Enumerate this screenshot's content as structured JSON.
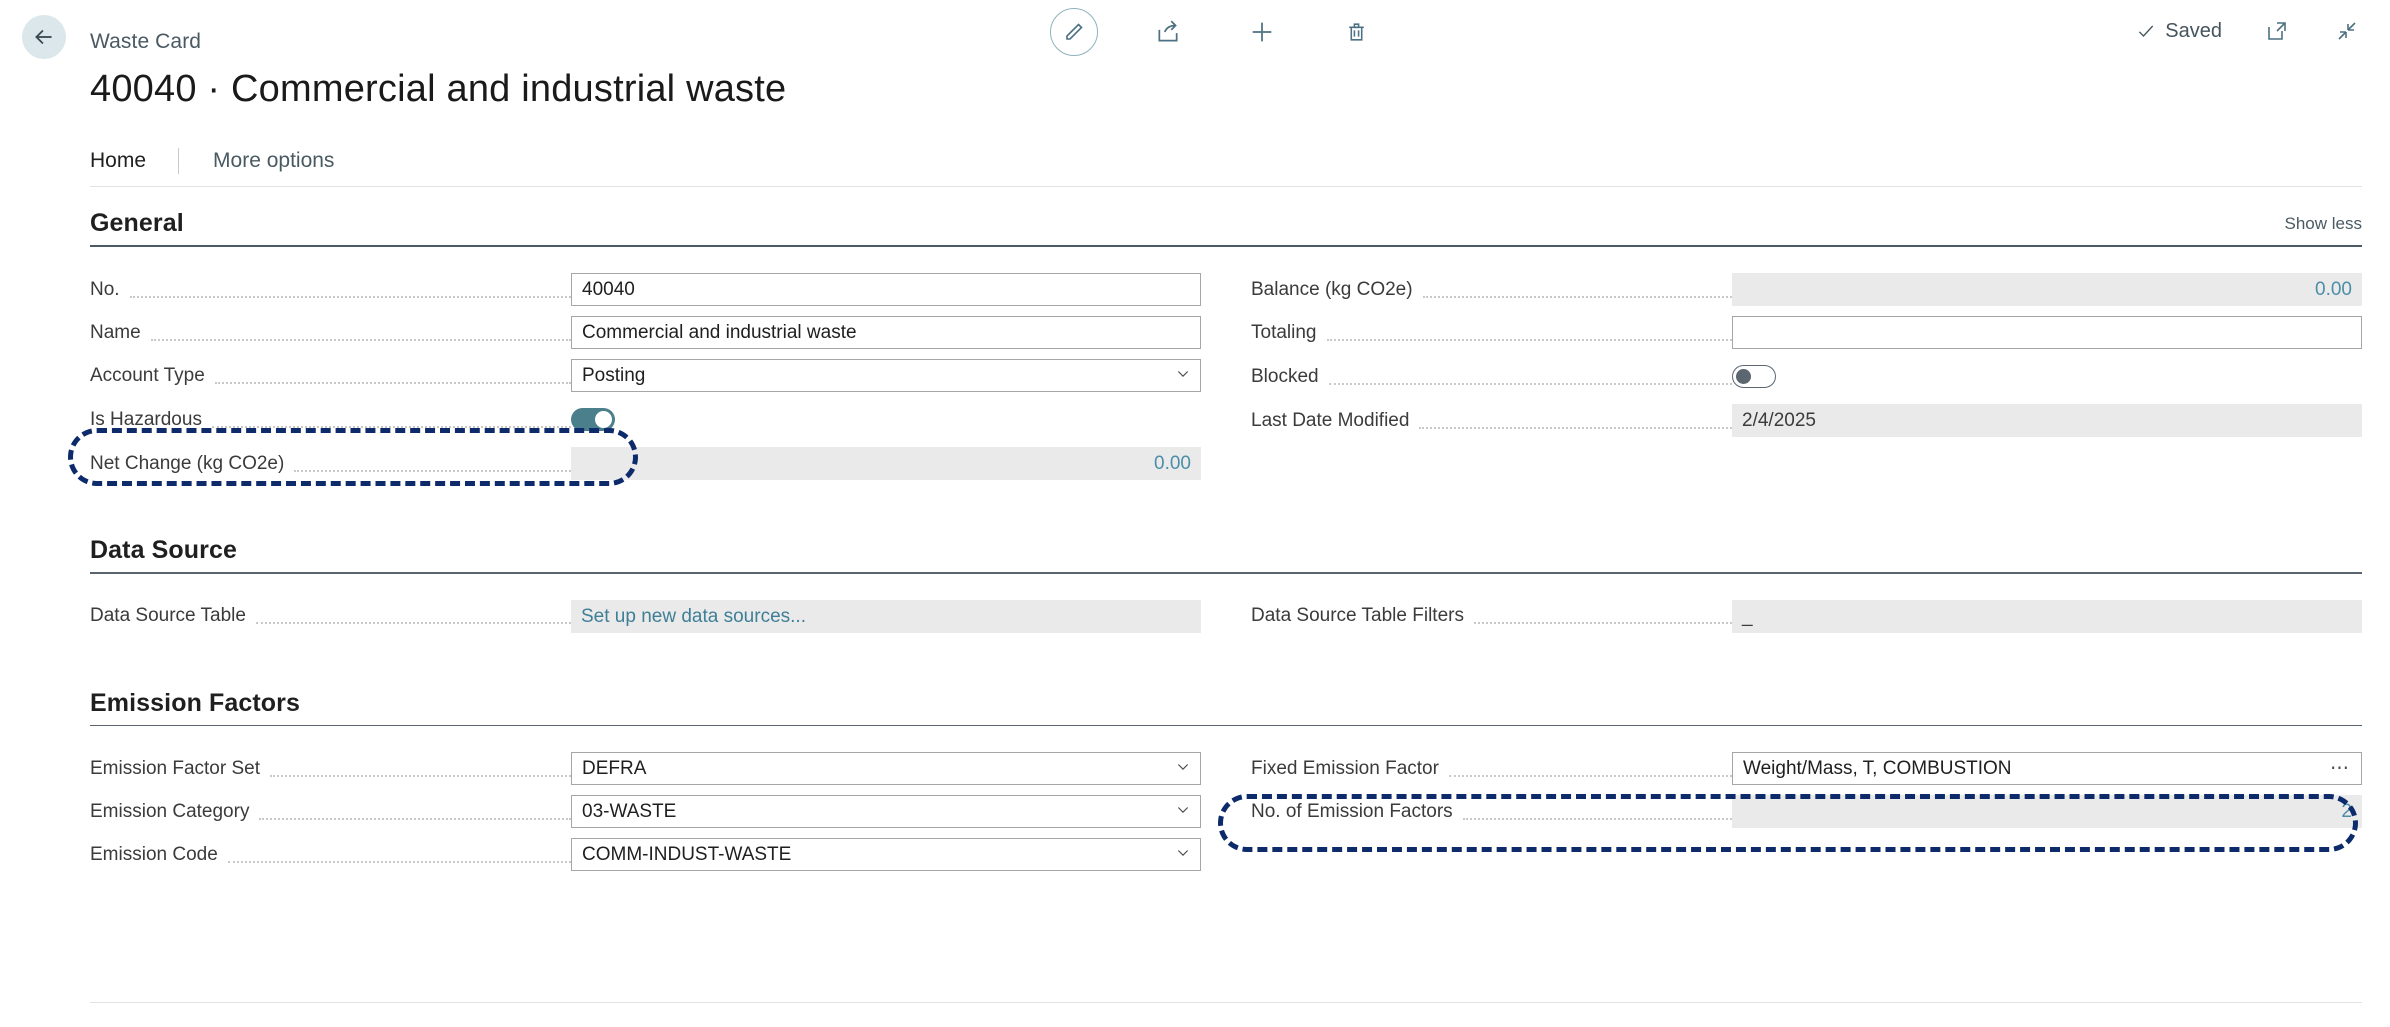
{
  "header": {
    "breadcrumb": "Waste Card",
    "page_title": "40040 · Commercial and industrial waste",
    "back_icon": "back-arrow-icon",
    "toolbar": [
      {
        "name": "edit-pencil-icon",
        "label": "Edit"
      },
      {
        "name": "share-icon",
        "label": "Share"
      },
      {
        "name": "plus-icon",
        "label": "New"
      },
      {
        "name": "trash-icon",
        "label": "Delete"
      }
    ],
    "status": "Saved",
    "open_in_new_label": "Open in new window",
    "collapse_label": "Collapse"
  },
  "tabs": [
    {
      "label": "Home",
      "active": true
    },
    {
      "label": "More options",
      "active": false
    }
  ],
  "sections": {
    "general": {
      "title": "General",
      "show_less": "Show less",
      "left": [
        {
          "label": "No.",
          "value": "40040",
          "type": "text"
        },
        {
          "label": "Name",
          "value": "Commercial and industrial waste",
          "type": "text"
        },
        {
          "label": "Account Type",
          "value": "Posting",
          "type": "select"
        },
        {
          "label": "Is Hazardous",
          "value": "on",
          "type": "toggle"
        },
        {
          "label": "Net Change (kg CO2e)",
          "value": "0.00",
          "type": "readonly-number"
        }
      ],
      "right": [
        {
          "label": "Balance (kg CO2e)",
          "value": "0.00",
          "type": "readonly-number"
        },
        {
          "label": "Totaling",
          "value": "",
          "type": "text"
        },
        {
          "label": "Blocked",
          "value": "off",
          "type": "toggle"
        },
        {
          "label": "Last Date Modified",
          "value": "2/4/2025",
          "type": "readonly"
        }
      ]
    },
    "data_source": {
      "title": "Data Source",
      "left": [
        {
          "label": "Data Source Table",
          "value": "Set up new data sources...",
          "type": "readonly-link"
        }
      ],
      "right": [
        {
          "label": "Data Source Table Filters",
          "value": "_",
          "type": "readonly"
        }
      ]
    },
    "emission_factors": {
      "title": "Emission Factors",
      "left": [
        {
          "label": "Emission Factor Set",
          "value": "DEFRA",
          "type": "select"
        },
        {
          "label": "Emission Category",
          "value": "03-WASTE",
          "type": "select"
        },
        {
          "label": "Emission Code",
          "value": "COMM-INDUST-WASTE",
          "type": "select"
        }
      ],
      "right": [
        {
          "label": "Fixed Emission Factor",
          "value": "Weight/Mass, T, COMBUSTION",
          "type": "lookup"
        },
        {
          "label": "No. of Emission Factors",
          "value": "2",
          "type": "readonly-number"
        }
      ]
    }
  },
  "annotations": [
    {
      "name": "highlight-is-hazardous",
      "target": "Is Hazardous"
    },
    {
      "name": "highlight-fixed-emission-factor",
      "target": "Fixed Emission Factor"
    }
  ],
  "colors": {
    "accent_teal": "#4c7f8c",
    "link": "#3f7f96",
    "annotation": "#0d2b6b",
    "disabled_bg": "#eaeaea"
  }
}
